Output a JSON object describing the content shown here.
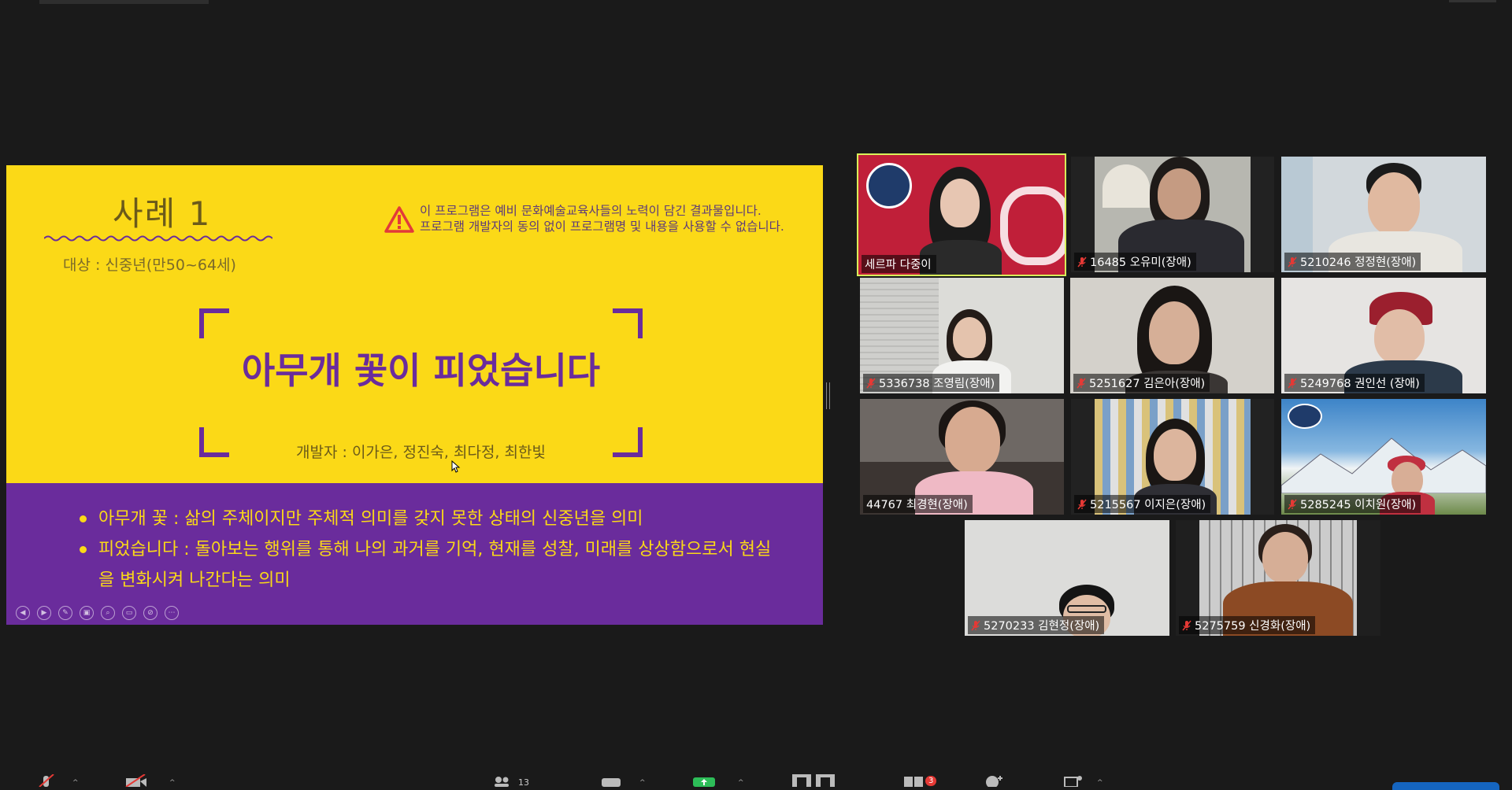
{
  "slide": {
    "case_title": "사례 1",
    "target": "대상 : 신중년(만50~64세)",
    "warning_line1": "이 프로그램은 예비 문화예술교육사들의 노력이 담긴 결과물입니다.",
    "warning_line2": "프로그램 개발자의 동의 없이 프로그램명 및 내용을 사용할 수 없습니다.",
    "program_title": "아무개 꽃이 피었습니다",
    "developers": "개발자 : 이가은, 정진숙, 최다정, 최한빛",
    "bullet1": "아무개 꽃 : 삶의 주체이지만 주체적 의미를 갖지 못한 상태의 신중년을 의미",
    "bullet2": "피었습니다 : 돌아보는 행위를 통해 나의 과거를 기억, 현재를 성찰, 미래를 상상함으로서 현실을 변화시켜 나간다는 의미",
    "colors": {
      "yellow": "#fbd917",
      "purple": "#6a2c9c"
    }
  },
  "participants": [
    {
      "name": "세르파 다중이",
      "muted": false,
      "active": true
    },
    {
      "name": "16485 오유미(장애)",
      "muted": true
    },
    {
      "name": "5210246 정정현(장애)",
      "muted": true
    },
    {
      "name": "5336738 조영림(장애)",
      "muted": true
    },
    {
      "name": "5251627 김은아(장애)",
      "muted": true
    },
    {
      "name": "5249768 권인선 (장애)",
      "muted": true
    },
    {
      "name": "44767 최경현(장애)",
      "muted": false
    },
    {
      "name": "5215567 이지은(장애)",
      "muted": true
    },
    {
      "name": "5285245 이치원(장애)",
      "muted": true
    },
    {
      "name": "5270233 김현정(장애)",
      "muted": true
    },
    {
      "name": "5275759 신경화(장애)",
      "muted": true
    }
  ],
  "toolbar": {
    "participants_count": "13",
    "reactions_badge": "3"
  }
}
